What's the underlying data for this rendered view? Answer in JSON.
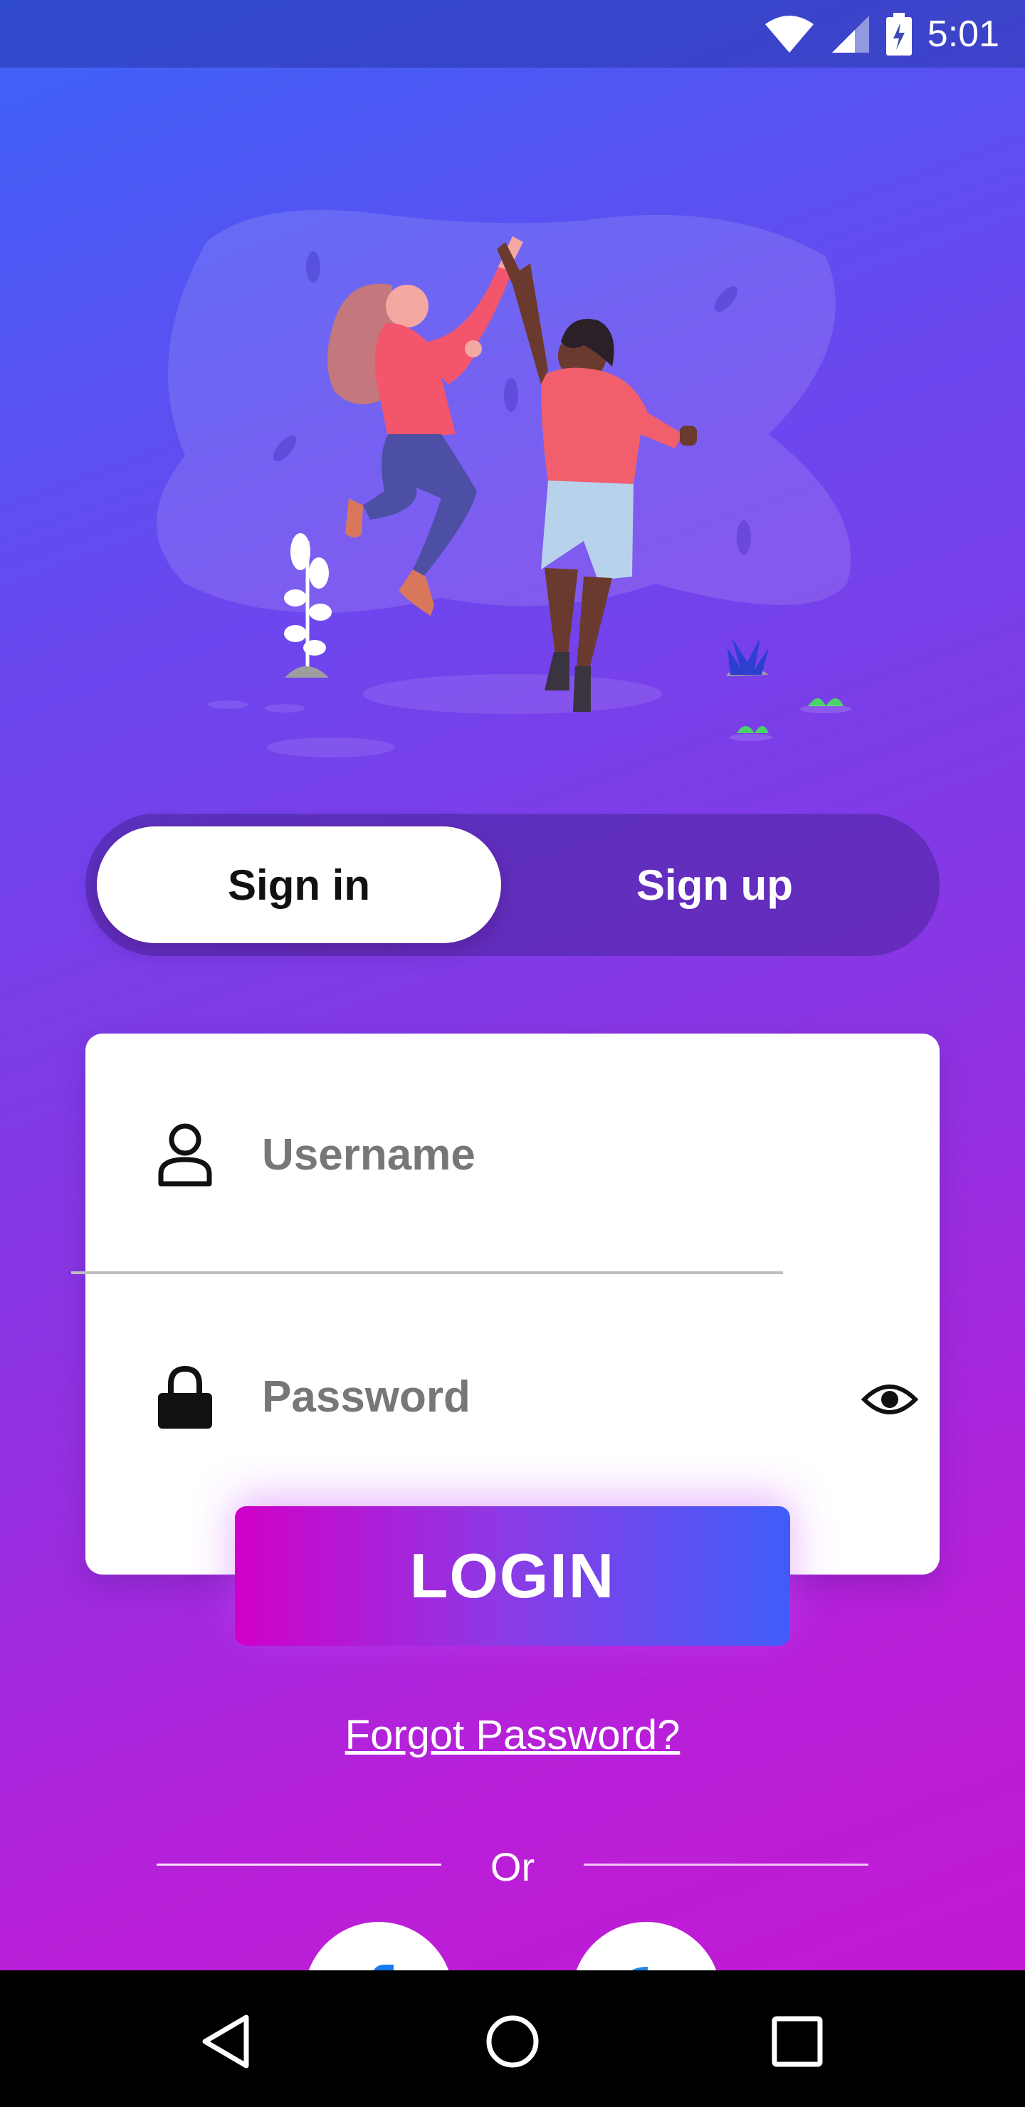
{
  "status_bar": {
    "time": "5:01",
    "icons": [
      "wifi-icon",
      "signal-icon",
      "battery-charging-icon"
    ]
  },
  "auth_toggle": {
    "signin_label": "Sign in",
    "signup_label": "Sign up",
    "selected": "Sign in"
  },
  "login_form": {
    "username_placeholder": "Username",
    "username_value": "",
    "password_placeholder": "Password",
    "password_value": "",
    "user_icon": "user-icon",
    "lock_icon": "lock-icon",
    "visibility_icon": "eye-icon",
    "login_label": "LOGIN"
  },
  "forgot_password_label": "Forgot Password?",
  "divider_label": "Or",
  "social": [
    "facebook-icon",
    "google-icon"
  ],
  "nav_bar": [
    "back-icon",
    "home-icon",
    "recents-icon"
  ],
  "colors": {
    "gradient_top": "#3b63f7",
    "gradient_bottom": "#c517d2",
    "button_left": "#d000c8",
    "button_right": "#3f5df8"
  }
}
